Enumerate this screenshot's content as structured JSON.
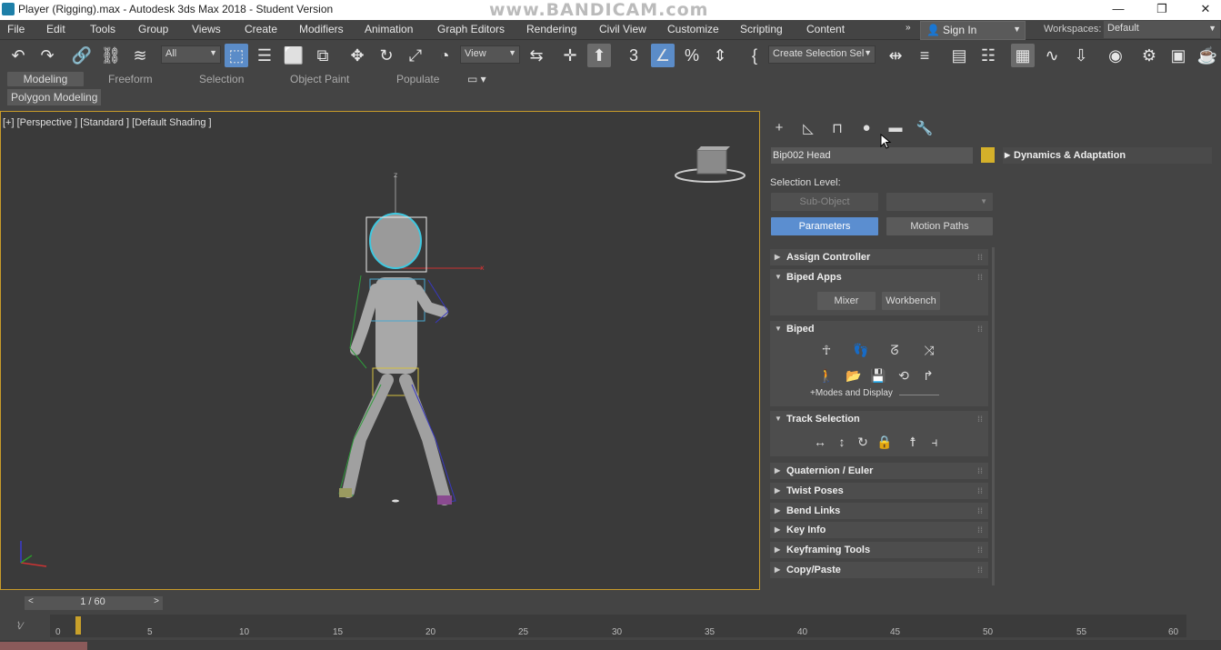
{
  "window": {
    "title": "Player (Rigging).max - Autodesk 3ds Max 2018 - Student Version",
    "watermark": "www.BANDICAM.com"
  },
  "menu": [
    "File",
    "Edit",
    "Tools",
    "Group",
    "Views",
    "Create",
    "Modifiers",
    "Animation",
    "Graph Editors",
    "Rendering",
    "Civil View",
    "Customize",
    "Scripting",
    "Content"
  ],
  "signin": {
    "label": "Sign In"
  },
  "workspaces": {
    "label": "Workspaces:",
    "value": "Default"
  },
  "toolbar": {
    "filter_value": "All",
    "refcoord_value": "View",
    "selection_set_value": "Create Selection Sel"
  },
  "ribbon": {
    "tabs": [
      "Modeling",
      "Freeform",
      "Selection",
      "Object Paint",
      "Populate"
    ],
    "active_tab": "Modeling",
    "panel": "Polygon Modeling"
  },
  "viewport": {
    "label": "[+] [Perspective ] [Standard ] [Default Shading ]",
    "gizmo_axis_z": "z",
    "gizmo_axis_x": "x"
  },
  "command_panel": {
    "object_name": "Bip002 Head",
    "object_color": "#d4b02a",
    "dynamics_rollout": "Dynamics & Adaptation",
    "selection_level_label": "Selection Level:",
    "subobject_label": "Sub-Object",
    "parameters_label": "Parameters",
    "motion_paths_label": "Motion Paths",
    "rollouts": {
      "assign_controller": "Assign Controller",
      "biped_apps": "Biped Apps",
      "mixer": "Mixer",
      "workbench": "Workbench",
      "biped": "Biped",
      "modes_display": "+Modes and Display",
      "track_selection": "Track Selection",
      "quaternion_euler": "Quaternion / Euler",
      "twist_poses": "Twist Poses",
      "bend_links": "Bend Links",
      "key_info": "Key Info",
      "keyframing_tools": "Keyframing Tools",
      "copy_paste": "Copy/Paste"
    }
  },
  "timeline": {
    "current": "1 / 60",
    "ticks": [
      "0",
      "5",
      "10",
      "15",
      "20",
      "25",
      "30",
      "35",
      "40",
      "45",
      "50",
      "55",
      "60"
    ]
  }
}
